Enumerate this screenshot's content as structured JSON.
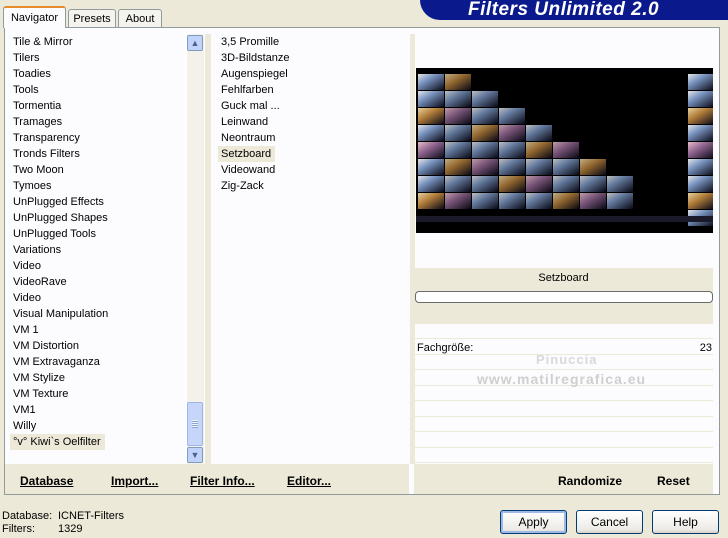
{
  "tabs": [
    "Navigator",
    "Presets",
    "About"
  ],
  "banner_title": "Filters Unlimited 2.0",
  "categories": [
    "Tile & Mirror",
    "Tilers",
    "Toadies",
    "Tools",
    "Tormentia",
    "Tramages",
    "Transparency",
    "Tronds Filters",
    "Two Moon",
    "Tymoes",
    "UnPlugged Effects",
    "UnPlugged Shapes",
    "UnPlugged Tools",
    "Variations",
    "Video",
    "VideoRave",
    "Video",
    "Visual Manipulation",
    "VM 1",
    "VM Distortion",
    "VM Extravaganza",
    "VM Stylize",
    "VM Texture",
    "VM1",
    "Willy",
    "°v° Kiwi`s Oelfilter"
  ],
  "filters": [
    "3,5 Promille",
    "3D-Bildstanze",
    "Augenspiegel",
    "Fehlfarben",
    "Guck mal ...",
    "Leinwand",
    "Neontraum",
    "Setzboard",
    "Videowand",
    "Zig-Zack"
  ],
  "selected_category": "°v° Kiwi`s Oelfilter",
  "selected_filter": "Setzboard",
  "links": {
    "database": "Database",
    "import": "Import...",
    "filter_info": "Filter Info...",
    "editor": "Editor...",
    "randomize": "Randomize",
    "reset": "Reset"
  },
  "preview_filter_name": "Setzboard",
  "parameter": {
    "label": "Fachgröße:",
    "value": "23"
  },
  "watermark": {
    "line1": "Pinuccia",
    "line2": "www.matilregrafica.eu"
  },
  "status": {
    "database_label": "Database:",
    "database_value": "ICNET-Filters",
    "filters_label": "Filters:",
    "filters_value": "1329"
  },
  "buttons": {
    "apply": "Apply",
    "cancel": "Cancel",
    "help": "Help"
  },
  "colors": {
    "banner": "#0a1a8c",
    "window_bg": "#ece9d8",
    "active_tab_accent": "#e68b2c"
  }
}
